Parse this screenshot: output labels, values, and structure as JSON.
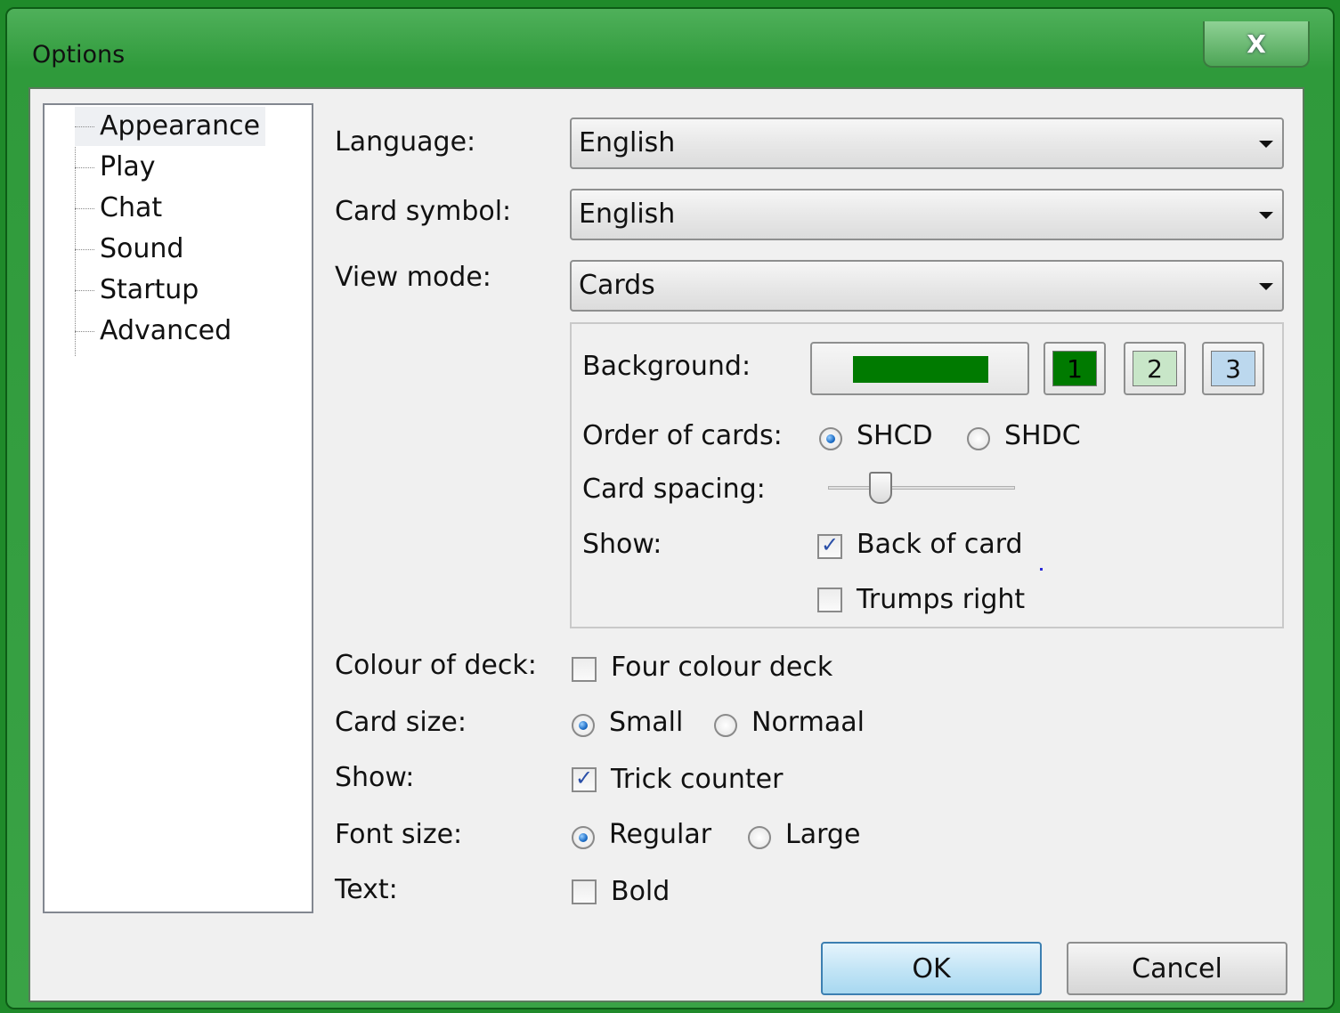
{
  "window": {
    "title": "Options",
    "close_glyph": "X"
  },
  "tree": {
    "items": [
      {
        "label": "Appearance",
        "selected": true
      },
      {
        "label": "Play"
      },
      {
        "label": "Chat"
      },
      {
        "label": "Sound"
      },
      {
        "label": "Startup"
      },
      {
        "label": "Advanced"
      }
    ]
  },
  "language": {
    "label": "Language:",
    "value": "English"
  },
  "card_symbol": {
    "label": "Card symbol:",
    "value": "English"
  },
  "view_mode": {
    "label": "View mode:",
    "value": "Cards"
  },
  "cards_group": {
    "background": {
      "label": "Background:",
      "color": "#007a00",
      "presets": [
        {
          "label": "1",
          "color": "#007a00",
          "text_color": "#000000"
        },
        {
          "label": "2",
          "color": "#c8e6c8",
          "text_color": "#111111"
        },
        {
          "label": "3",
          "color": "#bcd8ee",
          "text_color": "#111111"
        }
      ]
    },
    "order": {
      "label": "Order of cards:",
      "options": [
        "SHCD",
        "SHDC"
      ],
      "selected": "SHCD"
    },
    "spacing": {
      "label": "Card spacing:",
      "level": 0.28
    },
    "show": {
      "label": "Show:",
      "back_of_card": {
        "label": "Back of card",
        "checked": true
      },
      "trumps_right": {
        "label": "Trumps right",
        "checked": false
      }
    }
  },
  "colour_of_deck": {
    "label": "Colour of deck:",
    "option": "Four colour deck",
    "checked": false
  },
  "card_size": {
    "label": "Card size:",
    "options": [
      "Small",
      "Normaal"
    ],
    "selected": "Small"
  },
  "show": {
    "label": "Show:",
    "option": "Trick counter",
    "checked": true
  },
  "font_size": {
    "label": "Font size:",
    "options": [
      "Regular",
      "Large"
    ],
    "selected": "Regular"
  },
  "text": {
    "label": "Text:",
    "option": "Bold",
    "checked": false
  },
  "buttons": {
    "ok": "OK",
    "cancel": "Cancel"
  }
}
